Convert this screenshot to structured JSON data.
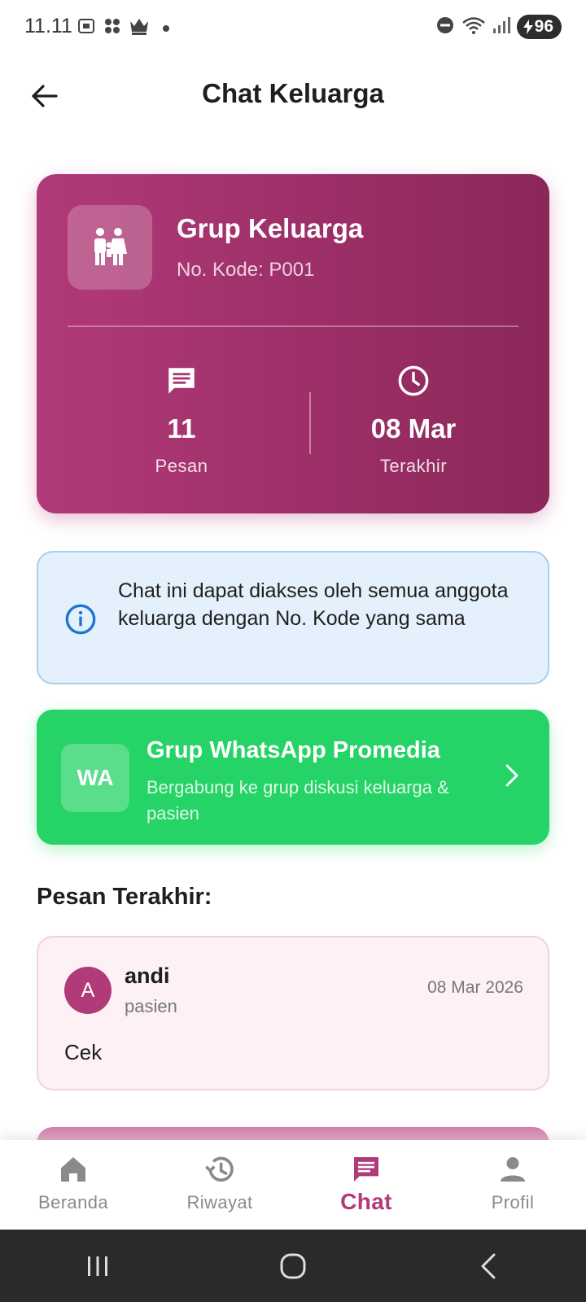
{
  "status_bar": {
    "time": "11.11",
    "battery": "96"
  },
  "header": {
    "title": "Chat Keluarga"
  },
  "group_card": {
    "name": "Grup Keluarga",
    "code": "No. Kode: P001",
    "stats": [
      {
        "value": "11",
        "label": "Pesan",
        "icon": "chat-icon"
      },
      {
        "value": "08 Mar",
        "label": "Terakhir",
        "icon": "clock-icon"
      }
    ]
  },
  "info": {
    "text": "Chat ini dapat diakses oleh semua anggota keluarga dengan No. Kode yang sama"
  },
  "whatsapp": {
    "badge": "WA",
    "title": "Grup WhatsApp Promedia",
    "subtitle": "Bergabung ke grup diskusi keluarga & pasien"
  },
  "messages_section": {
    "title": "Pesan Terakhir:",
    "items": [
      {
        "avatar": "A",
        "sender": "andi",
        "role": "pasien",
        "date": "08 Mar 2026",
        "text": "Cek"
      }
    ]
  },
  "bottom_nav": {
    "items": [
      {
        "label": "Beranda",
        "icon": "home-icon"
      },
      {
        "label": "Riwayat",
        "icon": "history-icon"
      },
      {
        "label": "Chat",
        "icon": "chat-icon",
        "active": true
      },
      {
        "label": "Profil",
        "icon": "person-icon"
      }
    ]
  },
  "colors": {
    "primary": "#b13a78",
    "whatsapp": "#25d366",
    "info_bg": "#e4f0fb",
    "info_accent": "#1976d2"
  }
}
